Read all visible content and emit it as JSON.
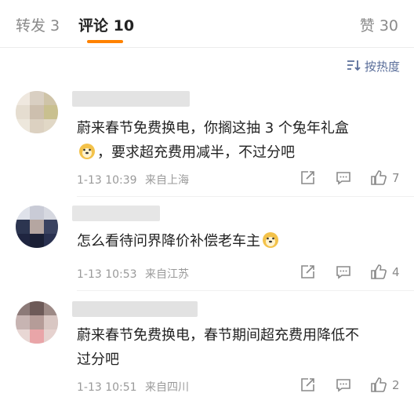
{
  "tabs": [
    {
      "label": "转发 3"
    },
    {
      "label": "评论 10"
    },
    {
      "label": "赞 30"
    }
  ],
  "sort_label": "按热度",
  "comments": [
    {
      "text_line1": "蔚来春节免费换电，你搁这抽 3 个兔年礼盒",
      "text_line2": "，要求超充费用减半，不过分吧",
      "time": "1-13 10:39",
      "location": "来自上海",
      "likes": "7"
    },
    {
      "text_line1": "怎么看待问界降价补偿老车主",
      "time": "1-13 10:53",
      "location": "来自江苏",
      "likes": "4"
    },
    {
      "text_line1": "蔚来春节免费换电，春节期间超充费用降低不",
      "text_line2": "过分吧",
      "time": "1-13 10:51",
      "location": "来自四川",
      "likes": "2"
    }
  ],
  "colors": {
    "accent": "#ff8200",
    "sort": "#5a6e9a",
    "meta": "#9a9a9a"
  }
}
